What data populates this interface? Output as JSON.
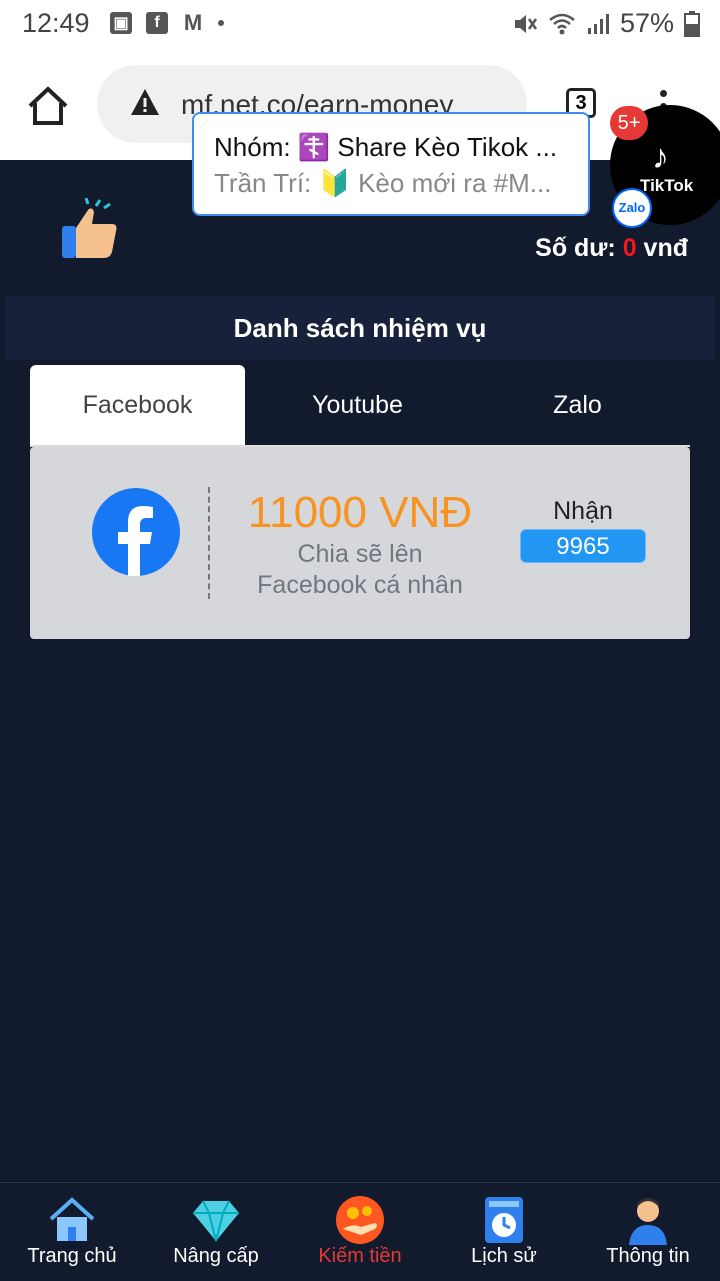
{
  "status": {
    "time": "12:49",
    "battery": "57%"
  },
  "browser": {
    "url": "mf.net.co/earn-money",
    "tab_count": "3"
  },
  "header": {
    "balance_label": "Số dư: ",
    "balance_value": "0",
    "balance_unit": " vnđ"
  },
  "section_title": "Danh sách nhiệm vụ",
  "tabs": [
    {
      "label": "Facebook",
      "active": true
    },
    {
      "label": "Youtube",
      "active": false
    },
    {
      "label": "Zalo",
      "active": false
    }
  ],
  "task": {
    "amount": "11000 VNĐ",
    "desc_line1": "Chia sẽ lên",
    "desc_line2": "Facebook cá nhân",
    "receive_label": "Nhận",
    "receive_count": "9965"
  },
  "notification": {
    "line1": "Nhóm: ☦️ Share Kèo Tikok ...",
    "line2": "Trần Trí: 🔰 Kèo mới ra  #M..."
  },
  "chat_head": {
    "badge": "5+",
    "app_label": "TikTok",
    "zalo_label": "Zalo"
  },
  "nav": [
    {
      "label": "Trang chủ",
      "icon": "home-icon"
    },
    {
      "label": "Nâng cấp",
      "icon": "diamond-icon"
    },
    {
      "label": "Kiếm tiền",
      "icon": "earn-money-icon",
      "active": true
    },
    {
      "label": "Lịch sử",
      "icon": "history-clock-icon"
    },
    {
      "label": "Thông tin",
      "icon": "user-profile-icon"
    }
  ],
  "colors": {
    "background": "#121a2e",
    "accent_orange": "#f7931e",
    "receive_blue": "#2196f3",
    "active_red": "#e53935"
  }
}
